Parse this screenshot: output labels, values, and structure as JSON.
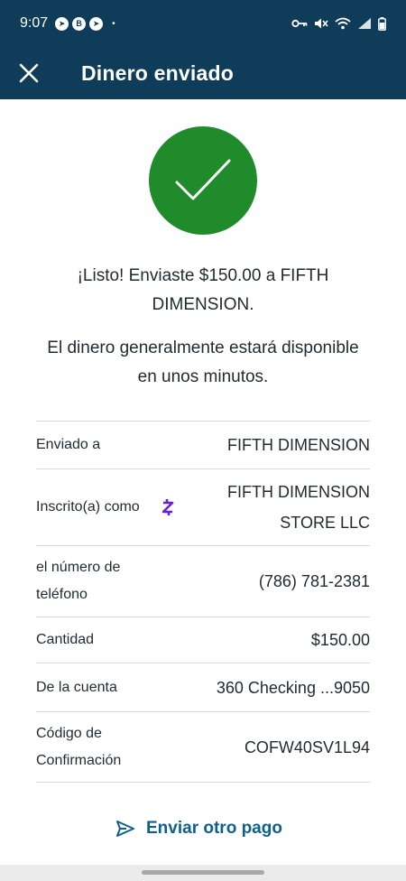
{
  "status_bar": {
    "time": "9:07",
    "notification_icons": [
      "telegram-icon",
      "b-icon",
      "telegram-icon"
    ],
    "dot": "•",
    "system_icons": [
      "key-icon",
      "mute-icon",
      "wifi-icon",
      "signal-icon",
      "battery-icon"
    ]
  },
  "header": {
    "title": "Dinero enviado",
    "close_icon": "close-icon",
    "background": "#0f3d59"
  },
  "success": {
    "icon": "checkmark-icon",
    "color": "#1f8b2a",
    "message": "¡Listo! Enviaste $150.00 a FIFTH DIMENSION.",
    "sub_message": "El dinero generalmente estará disponible en unos minutos."
  },
  "details": [
    {
      "label": "Enviado a",
      "value": "FIFTH DIMENSION"
    },
    {
      "label": "Inscrito(a) como",
      "value": "FIFTH DIMENSION STORE LLC",
      "icon": "zelle-icon"
    },
    {
      "label": "el número de teléfono",
      "value": "(786) 781-2381"
    },
    {
      "label": "Cantidad",
      "value": "$150.00"
    },
    {
      "label": "De la cuenta",
      "value": "360 Checking ...9050"
    },
    {
      "label": "Código de Confirmación",
      "value": "COFW40SV1L94"
    }
  ],
  "actions": {
    "send_again_label": "Enviar otro pago",
    "send_icon": "send-icon",
    "color": "#0f5f8c"
  }
}
